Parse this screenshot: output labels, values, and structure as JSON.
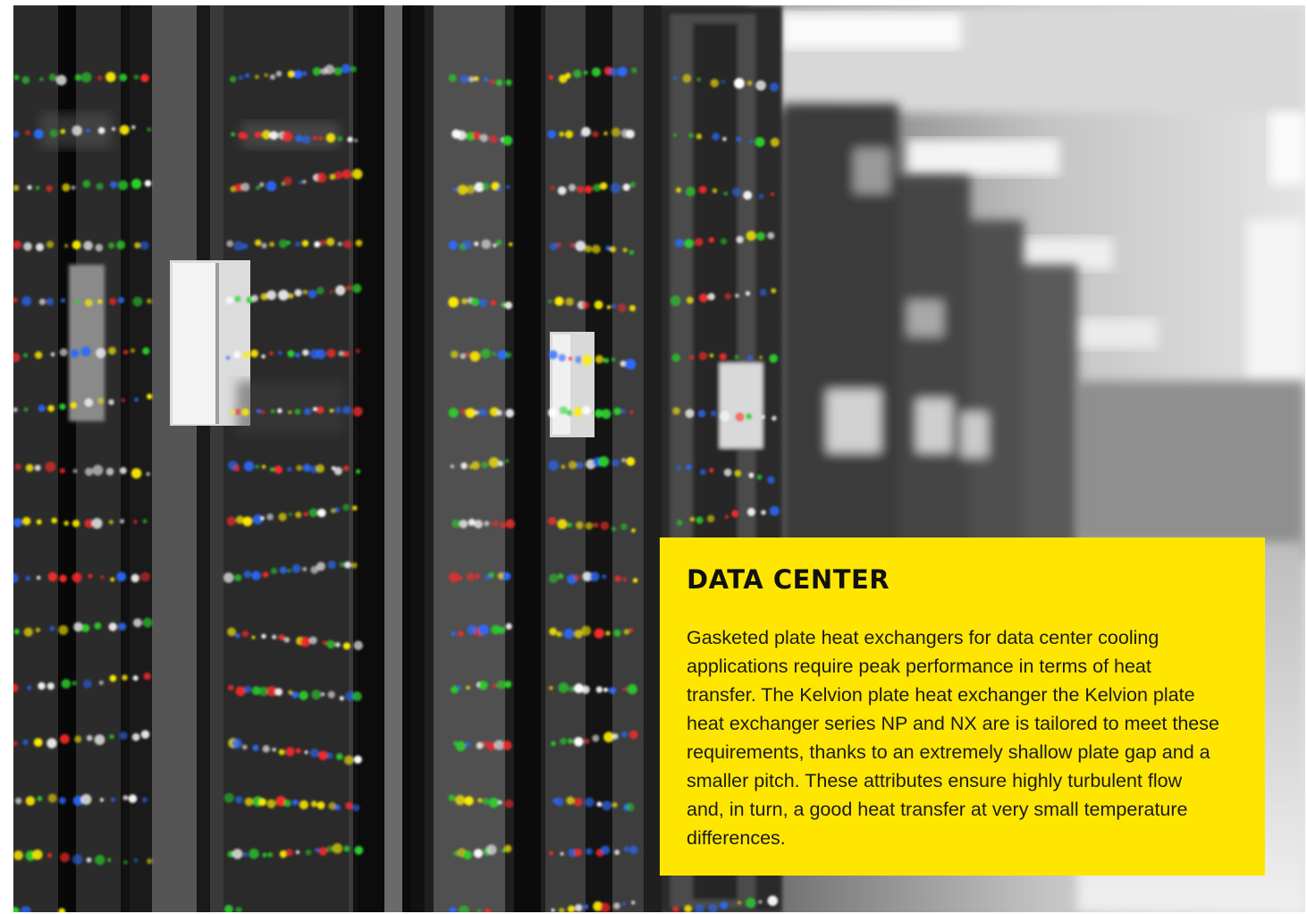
{
  "panel": {
    "title": "DATA CENTER",
    "body": "Gasketed plate heat exchangers for data center cooling applications require peak performance in terms of heat transfer. The Kelvion plate heat exchanger the Kelvion plate heat exchanger series NP and NX are is tailored to meet these requirements, thanks to an extremely shallow plate gap and a smaller pitch. These attributes ensure highly turbulent flow and, in turn, a good heat transfer at very small temperature differences."
  },
  "colors": {
    "panel_background": "#ffe600",
    "panel_text": "#111111",
    "led_colors": [
      "#ffffff",
      "#ffee00",
      "#2bd12b",
      "#ff2a2a",
      "#2a6bff"
    ]
  }
}
